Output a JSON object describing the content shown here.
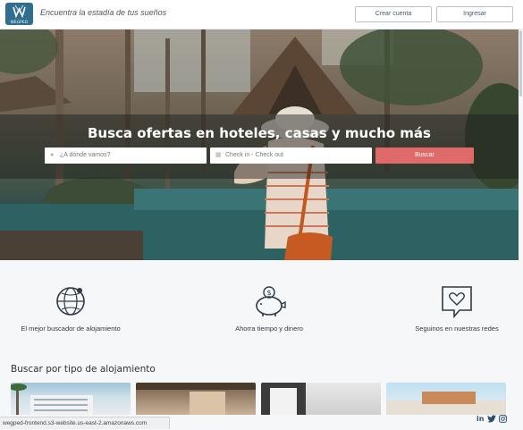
{
  "header": {
    "logo_text": "WEGPED",
    "tagline": "Encuentra la estadía de tus sueños",
    "create_account_label": "Crear cuenta",
    "login_label": "Ingresar"
  },
  "hero": {
    "title": "Busca ofertas en hoteles, casas y mucho más",
    "destination_placeholder": "¿A dónde vamos?",
    "dates_placeholder": "Check in - Check out",
    "search_label": "Buscar"
  },
  "features": [
    {
      "label": "El mejor buscador de alojamiento",
      "icon": "globe-icon"
    },
    {
      "label": "Ahorra tiempo y dinero",
      "icon": "piggy-bank-icon"
    },
    {
      "label": "Seguinos en nuestras redes",
      "icon": "heart-chat-icon"
    }
  ],
  "section": {
    "title": "Buscar por tipo de alojamiento"
  },
  "status_bar": {
    "url": "wegped-frontend.s3-website.us-east-2.amazonaws.com"
  },
  "social": {
    "linkedin": "in",
    "twitter": "twitter-icon",
    "instagram": "instagram-icon"
  },
  "colors": {
    "logo_bg": "#2f6e8f",
    "search_button": "#e06a6a",
    "header_bg": "#ffffff",
    "page_bg": "#f6f7f9"
  }
}
